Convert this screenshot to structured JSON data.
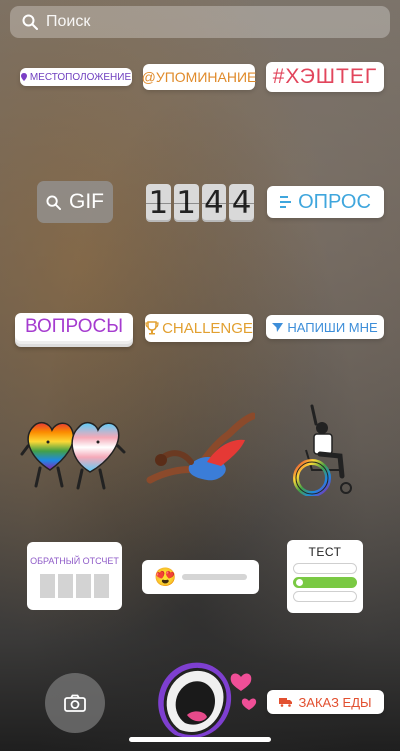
{
  "search": {
    "placeholder": "Поиск",
    "icon": "search-icon"
  },
  "stickers": {
    "location": "МЕСТОПОЛОЖЕНИЕ",
    "mention": "@УПОМИНАНИЕ",
    "hashtag": "#ХЭШТЕГ",
    "gif": "GIF",
    "countdown_digits": [
      "1",
      "1",
      "4",
      "4"
    ],
    "poll": "ОПРОС",
    "questions": "ВОПРОСЫ",
    "challenge": "CHALLENGE",
    "dm": "НАПИШИ МНЕ",
    "countdown_title": "ОБРАТНЫЙ ОТСЧЕТ",
    "quiz_title": "ТЕСТ",
    "food": "ЗАКАЗ ЕДЫ"
  },
  "colors": {
    "location": "#6f3fbf",
    "mention": "#e08b2b",
    "hashtag": "#e2455c",
    "poll": "#3fa6dd",
    "questions": "#a53bcf",
    "challenge": "#e2a030",
    "dm": "#3d8ed9",
    "food": "#e25030"
  },
  "emoji_slider": {
    "emoji": "😍"
  }
}
